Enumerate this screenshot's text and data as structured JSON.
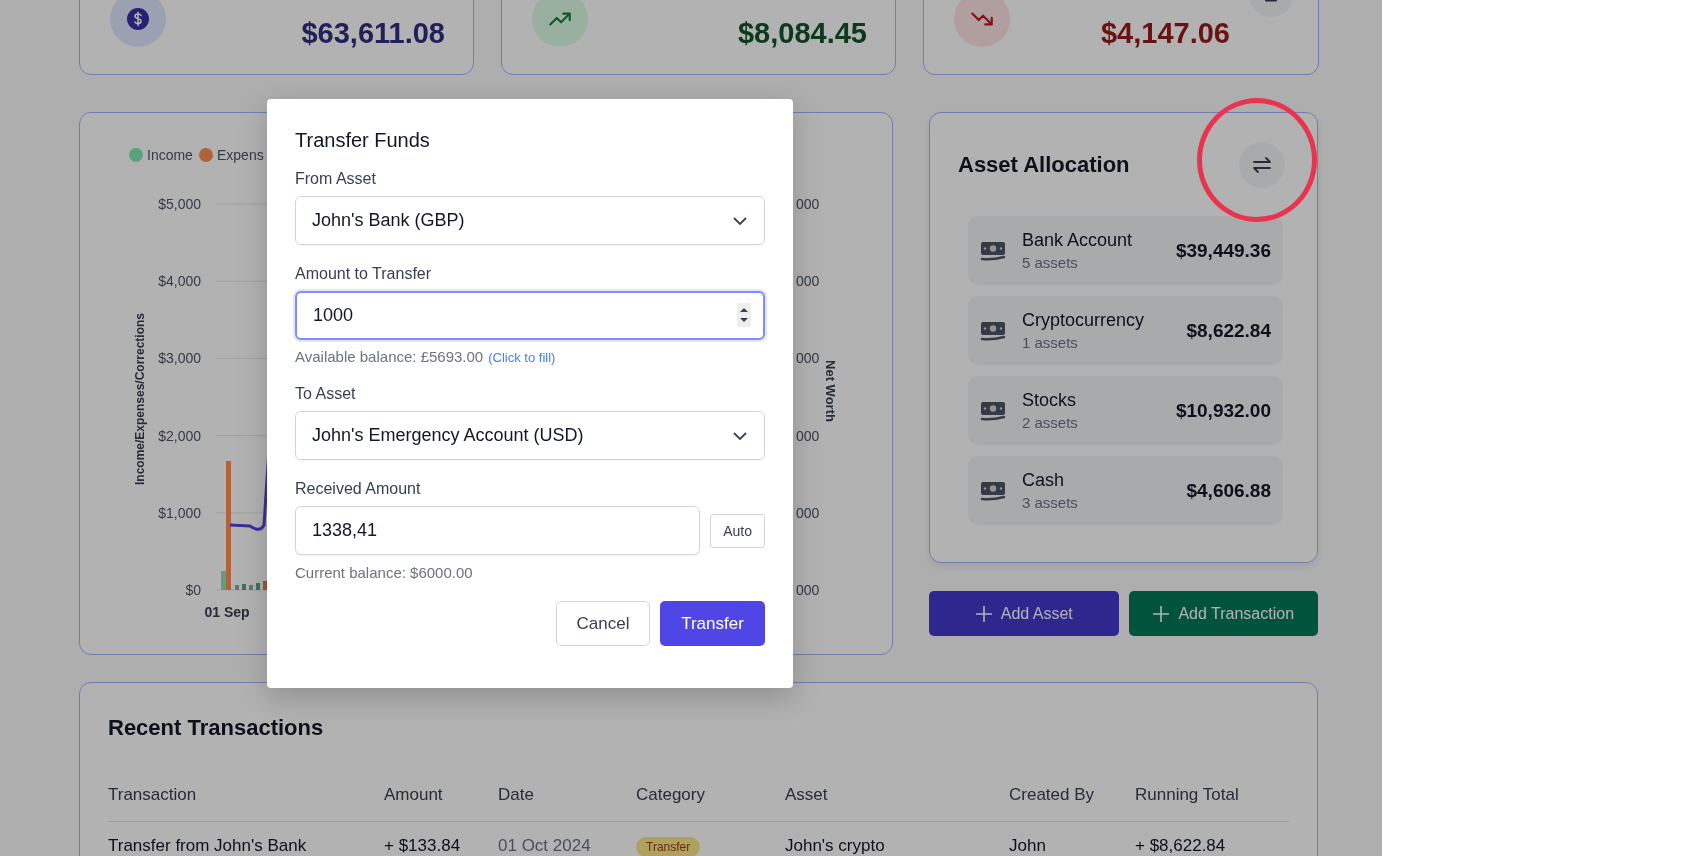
{
  "summary_cards": [
    {
      "kind": "net_worth",
      "value": "$63,611.08"
    },
    {
      "kind": "income",
      "value": "$8,084.45"
    },
    {
      "kind": "expenses",
      "value": "$4,147.06"
    }
  ],
  "chart": {
    "legend": [
      {
        "label": "Income",
        "color": "#5aa37f"
      },
      {
        "label": "Expens",
        "color": "#b0633d"
      }
    ],
    "y_axis_title": "Income/Expenses/Corrections",
    "y_ticks": [
      "$5,000",
      "$4,000",
      "$3,000",
      "$2,000",
      "$1,000",
      "$0"
    ],
    "x_labels": [
      "01 Sep"
    ],
    "right_ticks": [
      "000",
      "000",
      "000",
      "000",
      "000",
      "000"
    ],
    "right_axis_title": "Net Worth"
  },
  "asset_allocation": {
    "title": "Asset Allocation",
    "categories": [
      {
        "name": "Bank Account",
        "count": "5 assets",
        "total": "$39,449.36"
      },
      {
        "name": "Cryptocurrency",
        "count": "1 assets",
        "total": "$8,622.84"
      },
      {
        "name": "Stocks",
        "count": "2 assets",
        "total": "$10,932.00"
      },
      {
        "name": "Cash",
        "count": "3 assets",
        "total": "$4,606.88"
      }
    ]
  },
  "actions": [
    {
      "label": "Add Asset",
      "kind": "primary"
    },
    {
      "label": "Add Transaction",
      "kind": "success"
    }
  ],
  "transactions": {
    "title": "Recent Transactions",
    "columns": [
      "Transaction",
      "Amount",
      "Date",
      "Category",
      "Asset",
      "Created By",
      "Running Total"
    ],
    "rows": [
      {
        "transaction": "Transfer from John's Bank",
        "amount": "+ $133.84",
        "date": "01 Oct 2024",
        "category": "Transfer",
        "asset": "John's crypto",
        "created_by": "John",
        "running_total": "+ $8,622.84"
      }
    ]
  },
  "modal": {
    "title": "Transfer Funds",
    "from_label": "From Asset",
    "from_value": "John's Bank (GBP)",
    "amount_label": "Amount to Transfer",
    "amount_value": "1000",
    "amount_focused": true,
    "available": "Available balance: £5693.00",
    "fill_link": "(Click to fill)",
    "to_label": "To Asset",
    "to_value": "John's Emergency Account (USD)",
    "received_label": "Received Amount",
    "received_value": "1338,41",
    "auto_button": "Auto",
    "current": "Current balance: $6000.00",
    "buttons": [
      {
        "label": "Cancel",
        "kind": "secondary"
      },
      {
        "label": "Transfer",
        "kind": "primary"
      }
    ]
  }
}
